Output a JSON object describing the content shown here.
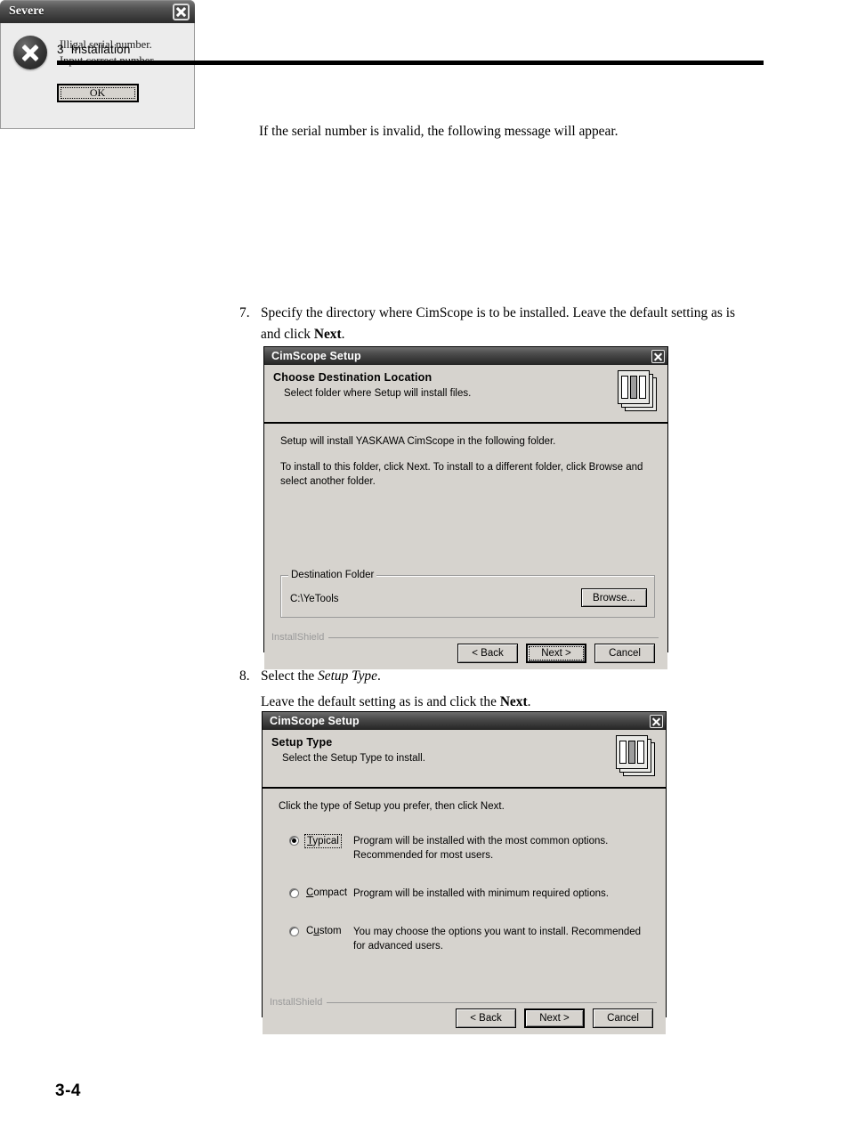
{
  "page": {
    "header_chapter": "3",
    "header_title": "Installation",
    "page_number": "3-4"
  },
  "intro": {
    "text": "If the serial number is invalid, the following message will appear."
  },
  "severe_dialog": {
    "title": "Severe",
    "close_icon": "close-icon",
    "error_icon": "error-x-icon",
    "message_line1": "Illigal serial number.",
    "message_line2": "Input correct number.",
    "ok_label": "OK"
  },
  "step7": {
    "number": "7.",
    "text_part1": "Specify the directory where CimScope is to be installed. Leave the default setting as is and click ",
    "bold_word": "Next",
    "text_part2": "."
  },
  "destination_dialog": {
    "title": "CimScope Setup",
    "close_icon": "close-icon",
    "header_title": "Choose Destination Location",
    "header_subtitle": "Select folder where Setup will install files.",
    "icon": "installshield-pages-icon",
    "body_para1": "Setup will install YASKAWA CimScope in the following folder.",
    "body_para2": "To install to this folder, click Next. To install to a different folder, click Browse and select another folder.",
    "group_title": "Destination Folder",
    "path_value": "C:\\YeTools",
    "browse_label": "Browse...",
    "installshield_label": "InstallShield",
    "back_label": "< Back",
    "next_label": "Next >",
    "cancel_label": "Cancel"
  },
  "step8": {
    "number": "8.",
    "line1_part1": "Select the ",
    "line1_italic": "Setup Type",
    "line1_part2": ".",
    "line2_part1": "Leave the default setting as is and click the ",
    "line2_bold": "Next",
    "line2_part2": "."
  },
  "setup_type_dialog": {
    "title": "CimScope Setup",
    "close_icon": "close-icon",
    "header_title": "Setup Type",
    "header_subtitle": "Select the Setup Type to install.",
    "icon": "installshield-pages-icon",
    "body_intro": "Click the type of Setup you prefer, then click Next.",
    "options": [
      {
        "label": "Typical",
        "accel": "T",
        "selected": true,
        "focused": true,
        "description": "Program will be installed with the most common options.  Recommended for most users."
      },
      {
        "label": "Compact",
        "accel": "C",
        "selected": false,
        "focused": false,
        "description": "Program will be installed with minimum required options."
      },
      {
        "label": "Custom",
        "accel": "u",
        "selected": false,
        "focused": false,
        "description": "You may choose the options you want to install. Recommended for advanced users."
      }
    ],
    "installshield_label": "InstallShield",
    "back_label": "< Back",
    "next_label": "Next >",
    "cancel_label": "Cancel"
  }
}
